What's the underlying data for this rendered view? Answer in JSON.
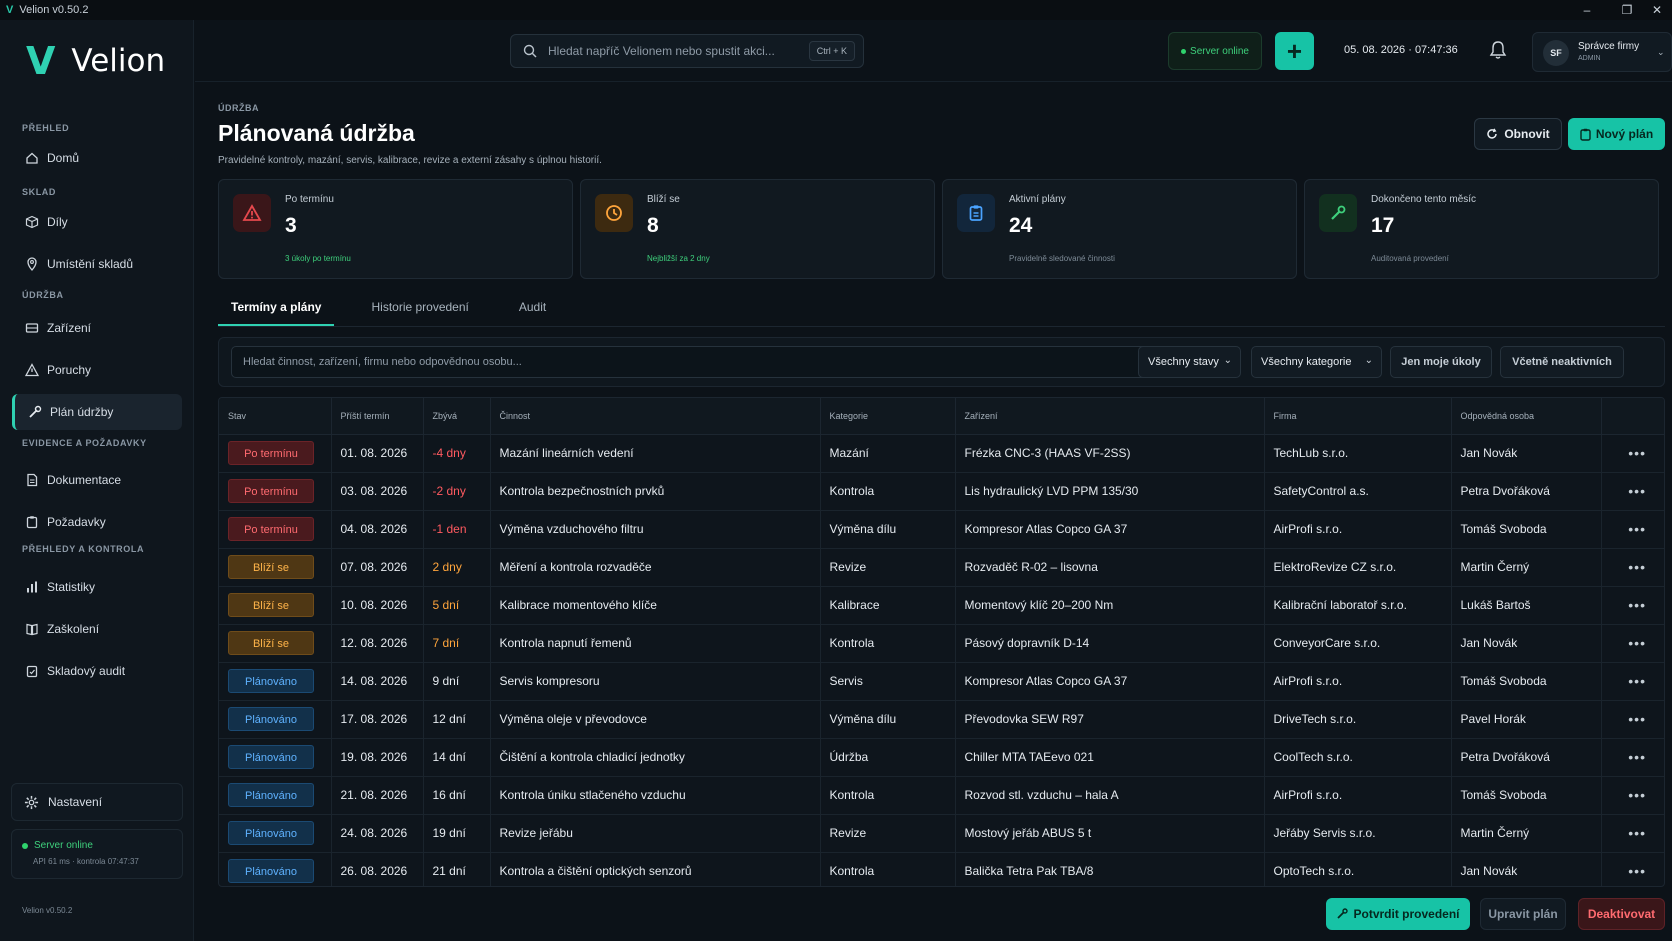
{
  "window": {
    "title": "Velion v0.50.2",
    "logo_letter": "V"
  },
  "brand": {
    "logo_letter": "V",
    "name": "Velion",
    "accent": "#2fd1b2"
  },
  "sidebar": {
    "sections": [
      {
        "title": "PŘEHLED",
        "items": [
          {
            "label": "Domů",
            "icon": "home-icon"
          }
        ]
      },
      {
        "title": "SKLAD",
        "items": [
          {
            "label": "Díly",
            "icon": "box-icon"
          },
          {
            "label": "Umístění skladů",
            "icon": "location-icon"
          }
        ]
      },
      {
        "title": "ÚDRŽBA",
        "items": [
          {
            "label": "Zařízení",
            "icon": "device-icon"
          },
          {
            "label": "Poruchy",
            "icon": "warning-icon"
          },
          {
            "label": "Plán údržby",
            "icon": "wrench-icon",
            "active": true
          }
        ]
      },
      {
        "title": "EVIDENCE A POŽADAVKY",
        "items": [
          {
            "label": "Dokumentace",
            "icon": "document-icon"
          },
          {
            "label": "Požadavky",
            "icon": "clipboard-icon"
          }
        ]
      },
      {
        "title": "PŘEHLEDY A KONTROLA",
        "items": [
          {
            "label": "Statistiky",
            "icon": "chart-icon"
          },
          {
            "label": "Zaškolení",
            "icon": "book-icon"
          },
          {
            "label": "Skladový audit",
            "icon": "audit-icon"
          }
        ]
      }
    ],
    "settings_label": "Nastavení",
    "server_status": "Server online",
    "server_detail": "API 61 ms · kontrola 07:47:37",
    "version": "Velion v0.50.2"
  },
  "topbar": {
    "search_placeholder": "Hledat napříč Velionem nebo spustit akci...",
    "shortcut": "Ctrl + K",
    "server_pill": "Server online",
    "datetime": "05. 08. 2026 · 07:47:36",
    "user_initials": "SF",
    "user_name": "Správce firmy",
    "user_role": "ADMIN"
  },
  "page": {
    "breadcrumb": "ÚDRŽBA",
    "title": "Plánovaná údržba",
    "subtitle": "Pravidelné kontroly, mazání, servis, kalibrace, revize a externí zásahy s úplnou historií.",
    "refresh_label": "Obnovit",
    "new_plan_label": "Nový plán"
  },
  "cards": [
    {
      "label": "Po termínu",
      "value": "3",
      "note": "3 úkoly po termínu",
      "note_green": true,
      "icon": "alert-triangle-icon",
      "color": "#e5484d",
      "bg": "#3a1619"
    },
    {
      "label": "Blíží se",
      "value": "8",
      "note": "Nejbližší za 2 dny",
      "note_green": true,
      "icon": "clock-icon",
      "color": "#ffa53c",
      "bg": "#3d2a10"
    },
    {
      "label": "Aktivní plány",
      "value": "24",
      "note": "Pravidelně sledované činnosti",
      "note_green": false,
      "icon": "clipboard-icon",
      "color": "#4aa3ff",
      "bg": "#12263b"
    },
    {
      "label": "Dokončeno tento měsíc",
      "value": "17",
      "note": "Auditovaná provedení",
      "note_green": false,
      "icon": "wrench-icon",
      "color": "#3ed07c",
      "bg": "#12301f"
    }
  ],
  "tabs": [
    {
      "label": "Termíny a plány",
      "active": true
    },
    {
      "label": "Historie provedení"
    },
    {
      "label": "Audit"
    }
  ],
  "filters": {
    "search_placeholder": "Hledat činnost, zařízení, firmu nebo odpovědnou osobu...",
    "status_select": "Všechny stavy",
    "category_select": "Všechny kategorie",
    "my_tasks": "Jen moje úkoly",
    "include_inactive": "Včetně neaktivních"
  },
  "table": {
    "columns": [
      "Stav",
      "Příští termín",
      "Zbývá",
      "Činnost",
      "Kategorie",
      "Zařízení",
      "Firma",
      "Odpovědná osoba",
      ""
    ],
    "rows": [
      {
        "status": "Po termínu",
        "kind": "over",
        "date": "01. 08. 2026",
        "remain": "-4 dny",
        "activity": "Mazání lineárních vedení",
        "category": "Mazání",
        "device": "Frézka CNC-3 (HAAS VF-2SS)",
        "firm": "TechLub s.r.o.",
        "person": "Jan Novák"
      },
      {
        "status": "Po termínu",
        "kind": "over",
        "date": "03. 08. 2026",
        "remain": "-2 dny",
        "activity": "Kontrola bezpečnostních prvků",
        "category": "Kontrola",
        "device": "Lis hydraulický LVD PPM 135/30",
        "firm": "SafetyControl a.s.",
        "person": "Petra Dvořáková"
      },
      {
        "status": "Po termínu",
        "kind": "over",
        "date": "04. 08. 2026",
        "remain": "-1 den",
        "activity": "Výměna vzduchového filtru",
        "category": "Výměna dílu",
        "device": "Kompresor Atlas Copco GA 37",
        "firm": "AirProfi s.r.o.",
        "person": "Tomáš Svoboda"
      },
      {
        "status": "Blíží se",
        "kind": "soon",
        "date": "07. 08. 2026",
        "remain": "2 dny",
        "activity": "Měření a kontrola rozvaděče",
        "category": "Revize",
        "device": "Rozvaděč R-02 – lisovna",
        "firm": "ElektroRevize CZ s.r.o.",
        "person": "Martin Černý"
      },
      {
        "status": "Blíží se",
        "kind": "soon",
        "date": "10. 08. 2026",
        "remain": "5 dní",
        "activity": "Kalibrace momentového klíče",
        "category": "Kalibrace",
        "device": "Momentový klíč 20–200 Nm",
        "firm": "Kalibrační laboratoř s.r.o.",
        "person": "Lukáš Bartoš"
      },
      {
        "status": "Blíží se",
        "kind": "soon",
        "date": "12. 08. 2026",
        "remain": "7 dní",
        "activity": "Kontrola napnutí řemenů",
        "category": "Kontrola",
        "device": "Pásový dopravník D-14",
        "firm": "ConveyorCare s.r.o.",
        "person": "Jan Novák"
      },
      {
        "status": "Plánováno",
        "kind": "plan",
        "date": "14. 08. 2026",
        "remain": "9 dní",
        "activity": "Servis kompresoru",
        "category": "Servis",
        "device": "Kompresor Atlas Copco GA 37",
        "firm": "AirProfi s.r.o.",
        "person": "Tomáš Svoboda"
      },
      {
        "status": "Plánováno",
        "kind": "plan",
        "date": "17. 08. 2026",
        "remain": "12 dní",
        "activity": "Výměna oleje v převodovce",
        "category": "Výměna dílu",
        "device": "Převodovka SEW R97",
        "firm": "DriveTech s.r.o.",
        "person": "Pavel Horák"
      },
      {
        "status": "Plánováno",
        "kind": "plan",
        "date": "19. 08. 2026",
        "remain": "14 dní",
        "activity": "Čištění a kontrola chladicí jednotky",
        "category": "Údržba",
        "device": "Chiller MTA TAEevo 021",
        "firm": "CoolTech s.r.o.",
        "person": "Petra Dvořáková"
      },
      {
        "status": "Plánováno",
        "kind": "plan",
        "date": "21. 08. 2026",
        "remain": "16 dní",
        "activity": "Kontrola úniku stlačeného vzduchu",
        "category": "Kontrola",
        "device": "Rozvod stl. vzduchu – hala A",
        "firm": "AirProfi s.r.o.",
        "person": "Tomáš Svoboda"
      },
      {
        "status": "Plánováno",
        "kind": "plan",
        "date": "24. 08. 2026",
        "remain": "19 dní",
        "activity": "Revize jeřábu",
        "category": "Revize",
        "device": "Mostový jeřáb ABUS 5 t",
        "firm": "Jeřáby Servis s.r.o.",
        "person": "Martin Černý"
      },
      {
        "status": "Plánováno",
        "kind": "plan",
        "date": "26. 08. 2026",
        "remain": "21 dní",
        "activity": "Kontrola a čištění optických senzorů",
        "category": "Kontrola",
        "device": "Balička Tetra Pak TBA/8",
        "firm": "OptoTech s.r.o.",
        "person": "Jan Novák"
      }
    ]
  },
  "footer": {
    "confirm_label": "Potvrdit provedení",
    "edit_label": "Upravit plán",
    "deactivate_label": "Deaktivovat"
  }
}
